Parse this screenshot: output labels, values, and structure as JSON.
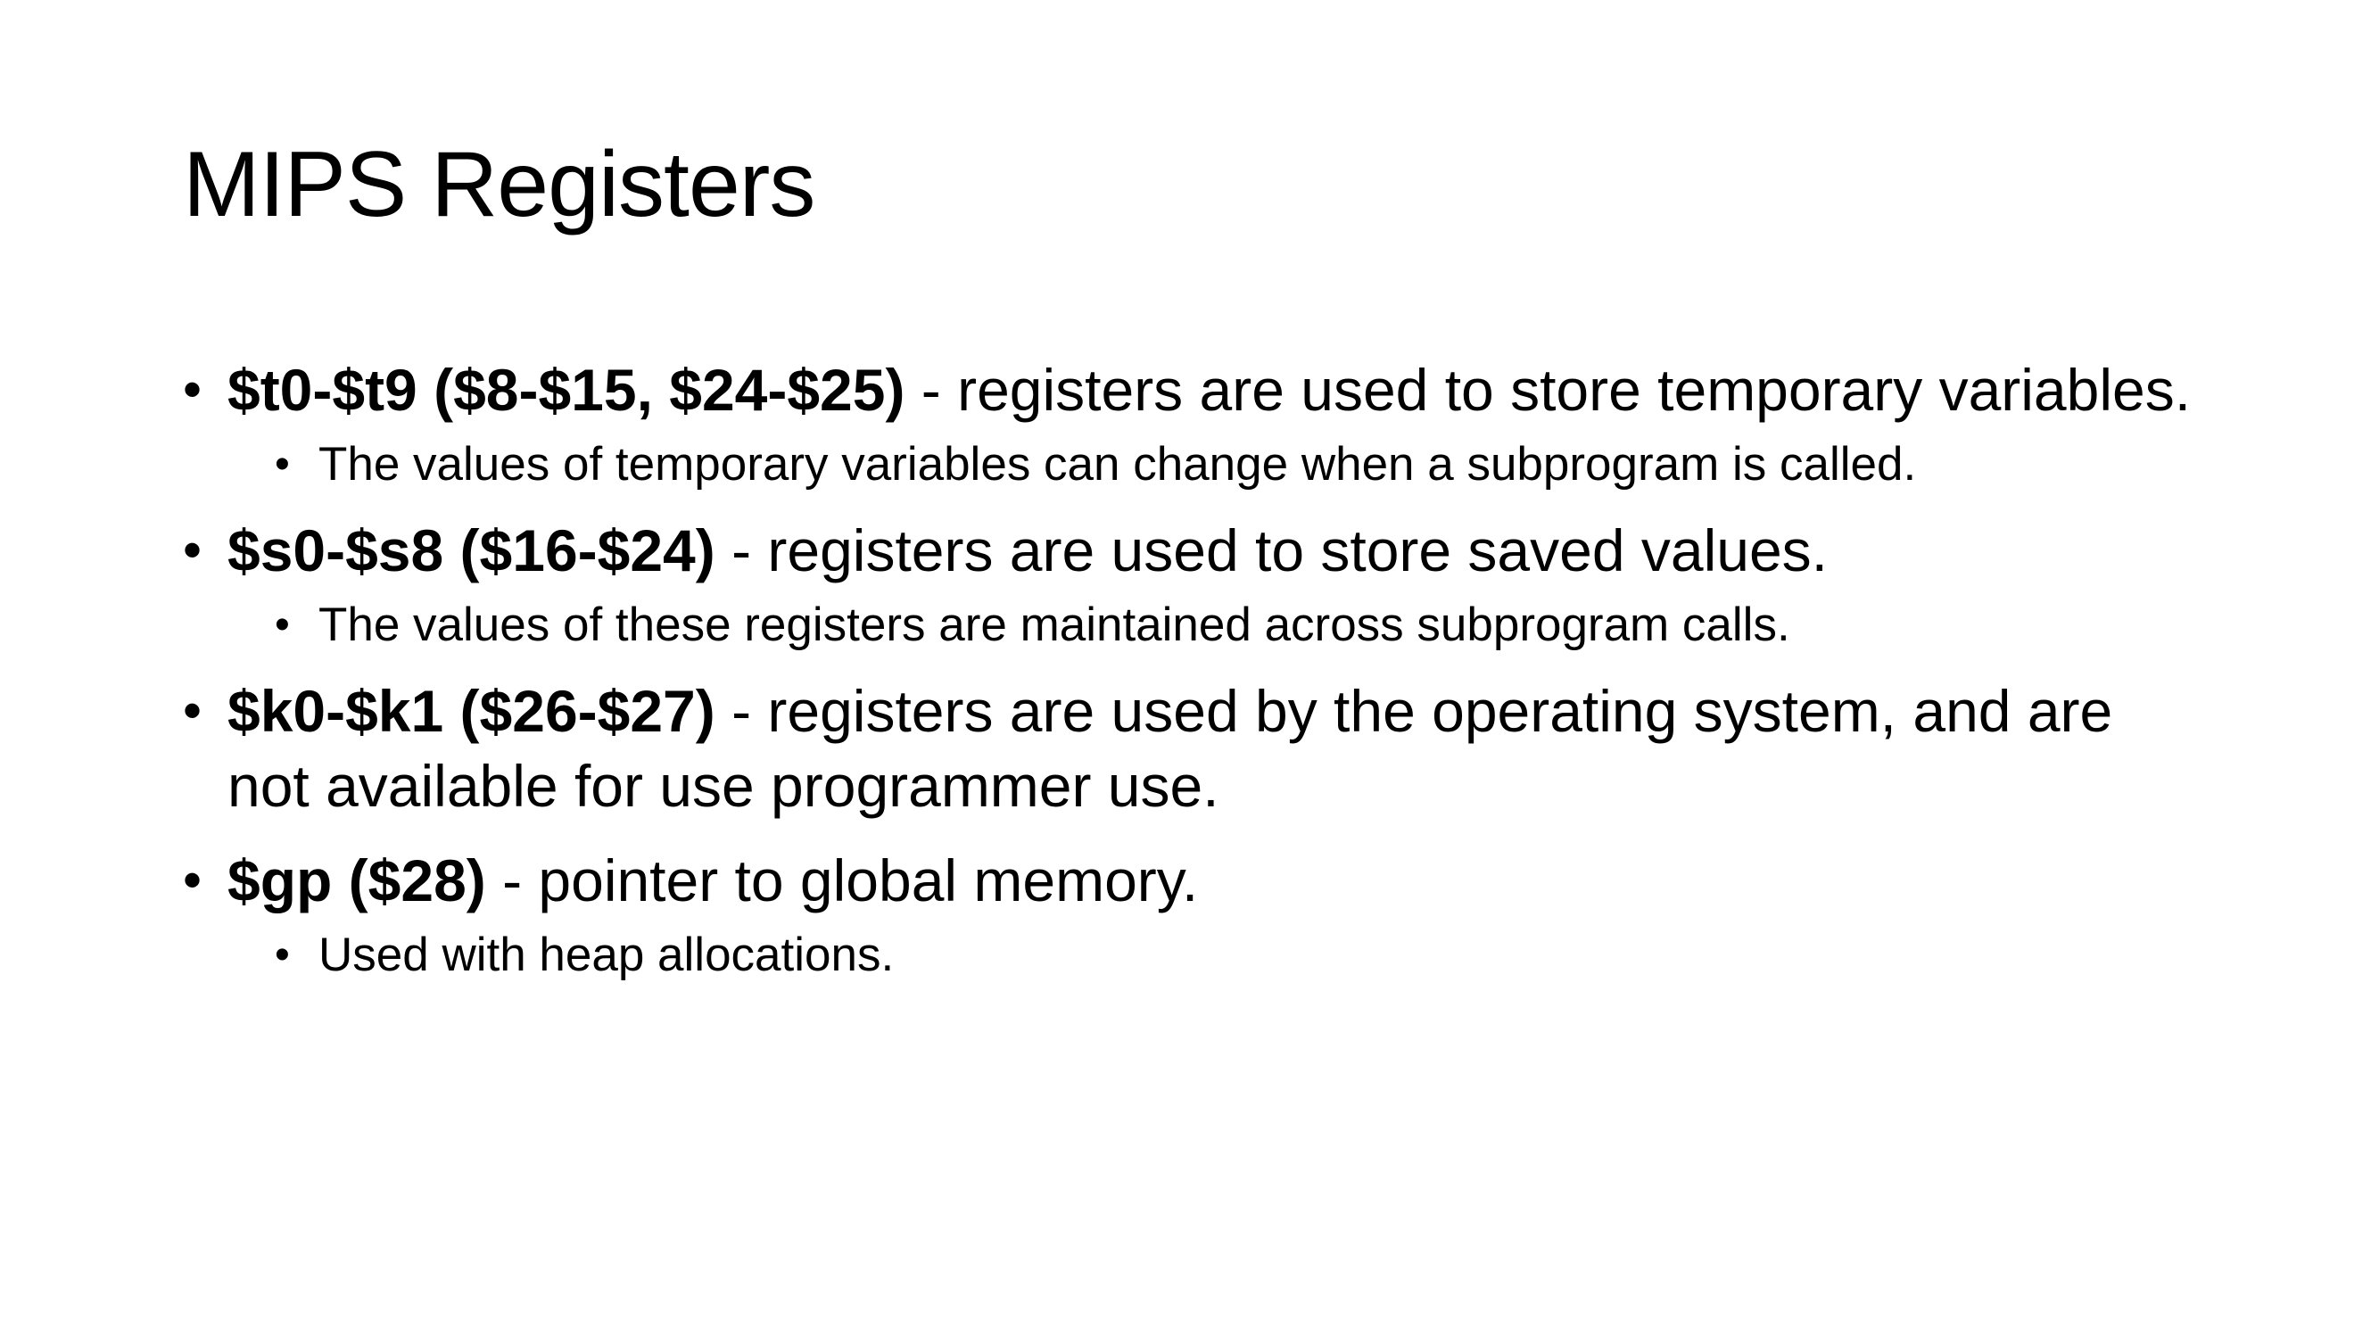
{
  "slide": {
    "title": "MIPS Registers",
    "items": [
      {
        "bold": "$t0-$t9 ($8-$15, $24-$25)",
        "text": " - registers are used to store temporary variables.",
        "sub": [
          "The values of temporary variables can change when a subprogram is called."
        ]
      },
      {
        "bold": "$s0-$s8 ($16-$24)",
        "text": " - registers are used to store saved values.",
        "sub": [
          "The values of these registers are maintained across subprogram calls."
        ]
      },
      {
        "bold": "$k0-$k1 ($26-$27)",
        "text": " - registers are used by the operating system, and are not available for use programmer use.",
        "sub": []
      },
      {
        "bold": "$gp ($28)",
        "text": " - pointer to global memory.",
        "sub": [
          "Used with heap allocations."
        ]
      }
    ],
    "bullet_char": "•",
    "colors": {
      "background": "#ffffff",
      "text": "#000000"
    }
  }
}
